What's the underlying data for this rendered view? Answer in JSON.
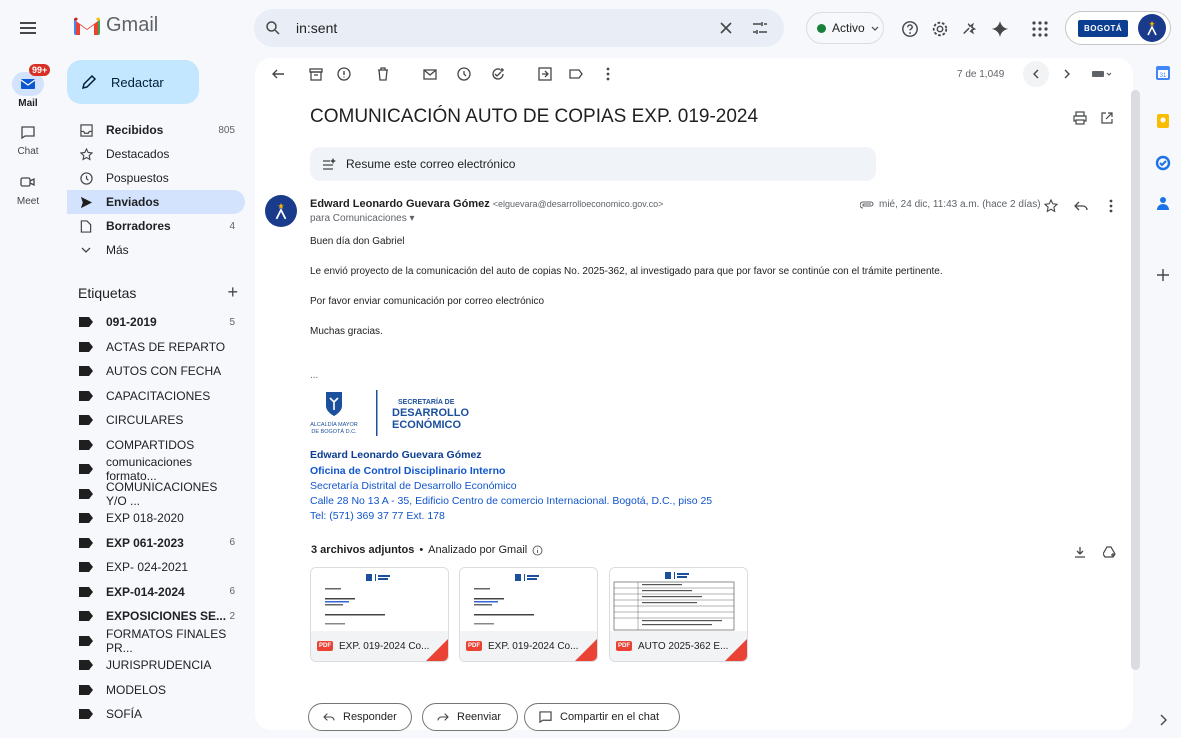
{
  "app": {
    "name": "Gmail"
  },
  "search": {
    "query": "in:sent"
  },
  "status": {
    "label": "Activo"
  },
  "account": {
    "brand": "BOGOTÁ"
  },
  "rail": {
    "mail_label": "Mail",
    "mail_badge": "99+",
    "chat_label": "Chat",
    "meet_label": "Meet"
  },
  "compose": {
    "label": "Redactar"
  },
  "nav": [
    {
      "label": "Recibidos",
      "count": "805",
      "icon": "inbox-icon",
      "bold": true
    },
    {
      "label": "Destacados",
      "count": "",
      "icon": "star-icon",
      "bold": false
    },
    {
      "label": "Pospuestos",
      "count": "",
      "icon": "clock-icon",
      "bold": false
    },
    {
      "label": "Enviados",
      "count": "",
      "icon": "send-icon",
      "bold": true,
      "active": true
    },
    {
      "label": "Borradores",
      "count": "4",
      "icon": "draft-icon",
      "bold": true
    },
    {
      "label": "Más",
      "count": "",
      "icon": "chevron-down-icon",
      "bold": false
    }
  ],
  "labels_heading": "Etiquetas",
  "labels": [
    {
      "label": "091-2019",
      "count": "5",
      "bold": true
    },
    {
      "label": "ACTAS DE REPARTO",
      "count": "",
      "bold": false
    },
    {
      "label": "AUTOS CON FECHA",
      "count": "",
      "bold": false
    },
    {
      "label": "CAPACITACIONES",
      "count": "",
      "bold": false
    },
    {
      "label": "CIRCULARES",
      "count": "",
      "bold": false
    },
    {
      "label": "COMPARTIDOS",
      "count": "",
      "bold": false
    },
    {
      "label": "comunicaciones formato...",
      "count": "",
      "bold": false
    },
    {
      "label": "COMUNICACIONES Y/O ...",
      "count": "",
      "bold": false
    },
    {
      "label": "EXP 018-2020",
      "count": "",
      "bold": false
    },
    {
      "label": "EXP 061-2023",
      "count": "6",
      "bold": true
    },
    {
      "label": "EXP- 024-2021",
      "count": "",
      "bold": false
    },
    {
      "label": "EXP-014-2024",
      "count": "6",
      "bold": true
    },
    {
      "label": "EXPOSICIONES SE...",
      "count": "2",
      "bold": true
    },
    {
      "label": "FORMATOS FINALES PR...",
      "count": "",
      "bold": false
    },
    {
      "label": "JURISPRUDENCIA",
      "count": "",
      "bold": false
    },
    {
      "label": "MODELOS",
      "count": "",
      "bold": false
    },
    {
      "label": "SOFÍA",
      "count": "",
      "bold": false
    }
  ],
  "toolbar": {
    "pager": "7 de 1,049"
  },
  "email": {
    "subject": "COMUNICACIÓN AUTO DE COPIAS EXP. 019-2024",
    "summarize": "Resume este correo electrónico",
    "sender_name": "Edward Leonardo Guevara Gómez",
    "sender_email": "<elguevara@desarrolloeconomico.gov.co>",
    "to": "para Comunicaciones",
    "date": "mié, 24 dic, 11:43 a.m. (hace 2 días)",
    "body": [
      "Buen día don Gabriel",
      "Le envió proyecto de la comunicación del auto de copias No. 2025-362, al investigado para que por favor se continúe con el trámite pertinente.",
      "Por favor enviar comunicación por correo electrónico",
      "Muchas gracias."
    ],
    "ellipsis": "...",
    "logo": {
      "left_text_1": "ALCALDÍA MAYOR",
      "left_text_2": "DE BOGOTÁ D.C.",
      "right_text_1": "SECRETARÍA DE",
      "right_text_2": "DESARROLLO",
      "right_text_3": "ECONÓMICO"
    },
    "signature": [
      "Edward Leonardo Guevara Gómez",
      "Oficina de Control Disciplinario Interno",
      "Secretaría Distrital de Desarrollo Económico",
      "Calle 28 No 13 A - 35, Edificio Centro de comercio Internacional. Bogotá, D.C., piso 25",
      "Tel: (571) 369 37 77 Ext. 178"
    ],
    "attachments_heading": "3 archivos adjuntos",
    "attachments_scan": "Analizado por Gmail",
    "attachments": [
      {
        "name": "EXP. 019-2024 Co...",
        "type": "PDF"
      },
      {
        "name": "EXP. 019-2024 Co...",
        "type": "PDF"
      },
      {
        "name": "AUTO 2025-362 E...",
        "type": "PDF"
      }
    ]
  },
  "actions": {
    "reply": "Responder",
    "forward": "Reenviar",
    "share": "Compartir en el chat"
  }
}
